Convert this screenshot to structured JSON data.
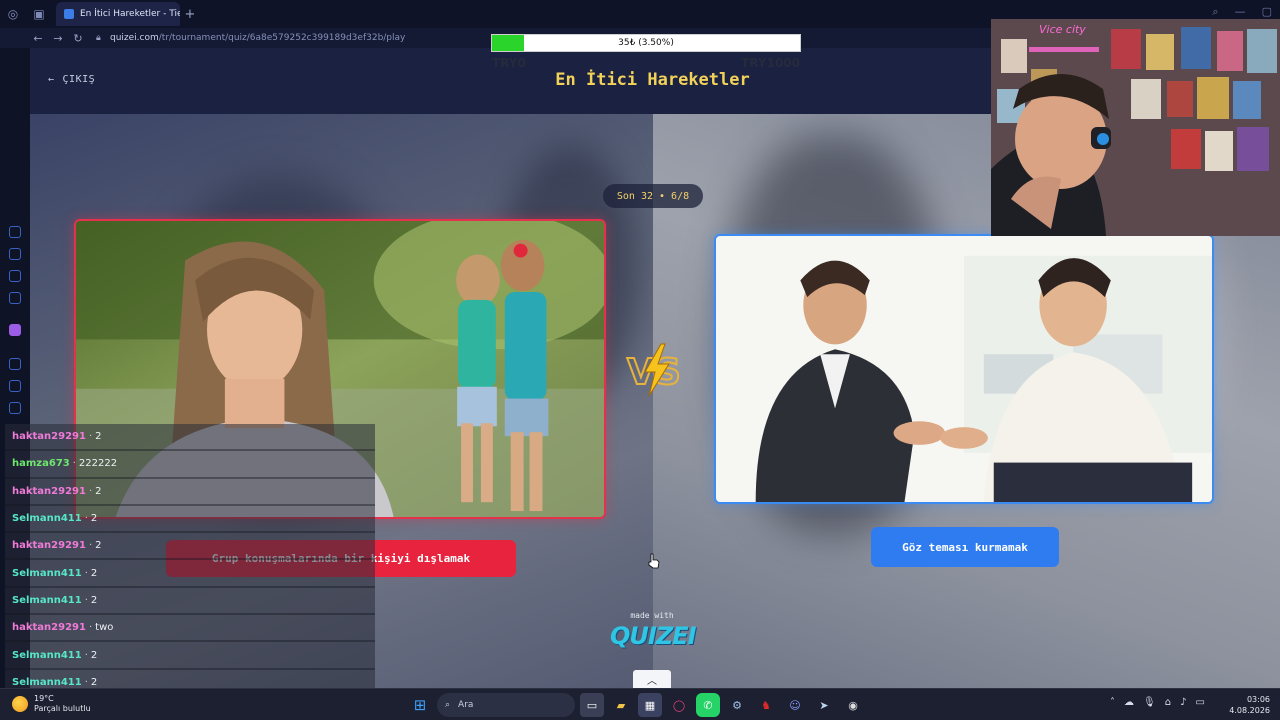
{
  "browser": {
    "tab_title": "En İtici Hareketler - Tier Lis",
    "url_domain": "quizei.com",
    "url_path": "/tr/tournament/quiz/6a8e579252c399189d3ef32b/play"
  },
  "header": {
    "exit_label": "ÇIKIŞ",
    "title": "En İtici Hareketler"
  },
  "round": {
    "label": "Son 32 • 6/8"
  },
  "left_choice": {
    "label": "Grup konuşmalarında bir kişiyi dışlamak",
    "accent_color": "#e8233e"
  },
  "right_choice": {
    "label": "Göz teması kurmamak",
    "accent_color": "#2f7cf0"
  },
  "branding": {
    "made_with": "made with",
    "brand_name": "QUIZEI"
  },
  "donation": {
    "progress_text": "35₺ (3.50%)",
    "progress_fraction": 0.035,
    "min_label": "TRY0",
    "max_label": "TRY1000"
  },
  "chat": [
    {
      "user": "haktan29291",
      "message": "2",
      "color": "#f07ad8"
    },
    {
      "user": "hamza673",
      "message": "222222",
      "color": "#6ee66e"
    },
    {
      "user": "haktan29291",
      "message": "2",
      "color": "#f07ad8"
    },
    {
      "user": "Selmann411",
      "message": "2",
      "color": "#57e6c8"
    },
    {
      "user": "haktan29291",
      "message": "2",
      "color": "#f07ad8"
    },
    {
      "user": "Selmann411",
      "message": "2",
      "color": "#57e6c8"
    },
    {
      "user": "Selmann411",
      "message": "2",
      "color": "#57e6c8"
    },
    {
      "user": "haktan29291",
      "message": "two",
      "color": "#f07ad8"
    },
    {
      "user": "Selmann411",
      "message": "2",
      "color": "#57e6c8"
    },
    {
      "user": "Selmann411",
      "message": "2",
      "color": "#57e6c8"
    }
  ],
  "taskbar": {
    "weather_temp": "19°C",
    "weather_desc": "Parçalı bulutlu",
    "search_placeholder": "Ara",
    "time": "03:06",
    "date": "4.08.2026"
  },
  "webcam": {
    "neon_sign": "Vice city"
  }
}
